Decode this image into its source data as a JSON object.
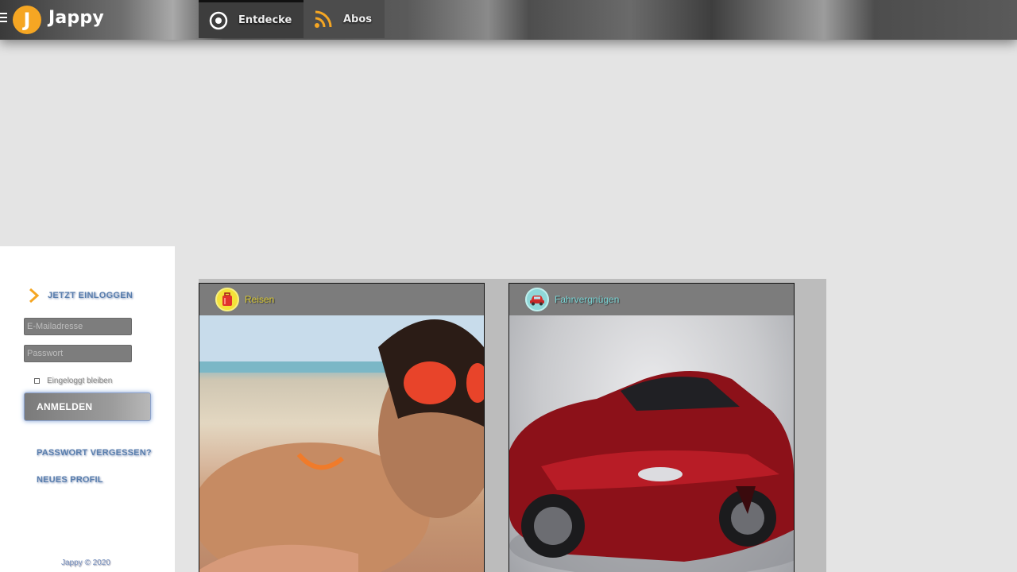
{
  "header": {
    "logo_letter": "J",
    "app_name": "Jappy",
    "tabs": [
      {
        "label": "Entdecke",
        "icon": "discover-icon"
      },
      {
        "label": "Abos",
        "icon": "rss-icon"
      }
    ]
  },
  "sidebar": {
    "login_heading": "JETZT EINLOGGEN",
    "email_placeholder": "E-Mailadresse",
    "password_placeholder": "Passwort",
    "remember_label": "Eingeloggt bleiben",
    "login_button": "ANMELDEN",
    "forgot_link": "PASSWORT VERGESSEN?",
    "new_profile_link": "NEUES PROFIL",
    "copyright": "Jappy © 2020"
  },
  "cards": [
    {
      "category": "Reisen",
      "icon": "suitcase-icon",
      "color": "#f4e23a"
    },
    {
      "category": "Fahrvergnügen",
      "icon": "car-icon",
      "color": "#8fd7d8"
    }
  ],
  "colors": {
    "accent": "#f5a623",
    "link": "#5a7fae"
  }
}
